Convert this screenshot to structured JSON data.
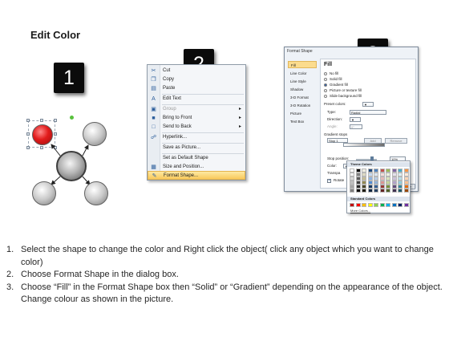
{
  "page_title": "Edit Color",
  "steps": [
    "1",
    "2",
    "3"
  ],
  "context_menu": {
    "items": [
      {
        "label": "Cut",
        "icon": "scissors-icon",
        "glyph": "✂"
      },
      {
        "label": "Copy",
        "icon": "copy-icon",
        "glyph": "❐"
      },
      {
        "label": "Paste",
        "icon": "paste-icon",
        "glyph": "▤"
      },
      {
        "label": "Edit Text",
        "icon": "edit-text-icon",
        "glyph": "A"
      },
      {
        "label": "Group",
        "icon": "group-icon",
        "glyph": "▣",
        "submenu": true,
        "disabled": true
      },
      {
        "label": "Bring to Front",
        "icon": "bring-to-front-icon",
        "glyph": "■",
        "submenu": true
      },
      {
        "label": "Send to Back",
        "icon": "send-to-back-icon",
        "glyph": "□",
        "submenu": true
      },
      {
        "label": "Hyperlink...",
        "icon": "hyperlink-icon",
        "glyph": "☍"
      },
      {
        "label": "Save as Picture...",
        "icon": "",
        "glyph": ""
      },
      {
        "label": "Set as Default Shape",
        "icon": "",
        "glyph": ""
      },
      {
        "label": "Size and Position...",
        "icon": "size-position-icon",
        "glyph": "▦"
      },
      {
        "label": "Format Shape...",
        "icon": "format-shape-icon",
        "glyph": "✎",
        "highlighted": true
      }
    ]
  },
  "dialog": {
    "title": "Format Shape",
    "nav": [
      "Fill",
      "Line Color",
      "Line Style",
      "Shadow",
      "3-D Format",
      "3-D Rotation",
      "Picture",
      "Text Box"
    ],
    "active_nav": "Fill",
    "heading": "Fill",
    "fill_options": [
      {
        "label": "No fill",
        "selected": false
      },
      {
        "label": "Solid fill",
        "selected": false
      },
      {
        "label": "Gradient fill",
        "selected": true
      },
      {
        "label": "Picture or texture fill",
        "selected": false
      },
      {
        "label": "Slide background fill",
        "selected": false
      }
    ],
    "preset_colors": "Preset colors:",
    "type_label": "Type:",
    "type_value": "Radial",
    "direction_label": "Direction:",
    "angle_label": "Angle:",
    "angle_value": "0°",
    "gradient_stops_label": "Gradient stops",
    "stop_value": "Stop 1",
    "add_label": "Add",
    "remove_label": "Remove",
    "stop_position_label": "Stop position:",
    "stop_position_value": "10%",
    "color_label": "Color:",
    "transparency_label": "Transpa",
    "rotate_label": "Rotate",
    "close_label": "se",
    "theme_colors_label": "Theme Colors",
    "standard_colors_label": "Standard Colors",
    "more_colors_label": "More Colors...",
    "theme_colors": [
      [
        "#ffffff",
        "#000000",
        "#eeece1",
        "#1f497d",
        "#4f81bd",
        "#c0504d",
        "#9bbb59",
        "#8064a2",
        "#4bacc6",
        "#f79646"
      ],
      [
        "#f2f2f2",
        "#7f7f7f",
        "#ddd9c3",
        "#c6d9f0",
        "#dbe5f1",
        "#f2dcdb",
        "#ebf1dd",
        "#e5e0ec",
        "#dbeef3",
        "#fdeada"
      ],
      [
        "#d8d8d8",
        "#595959",
        "#c4bd97",
        "#8db3e2",
        "#b8cce4",
        "#e5b9b7",
        "#d7e3bc",
        "#ccc1d9",
        "#b7dde8",
        "#fbd5b5"
      ],
      [
        "#bfbfbf",
        "#3f3f3f",
        "#938953",
        "#548dd4",
        "#95b3d7",
        "#d99694",
        "#c3d69b",
        "#b2a2c7",
        "#92cddc",
        "#fac08f"
      ],
      [
        "#a5a5a5",
        "#262626",
        "#494429",
        "#17365d",
        "#366092",
        "#953734",
        "#76923c",
        "#5f497a",
        "#31859b",
        "#e36c09"
      ],
      [
        "#7f7f7f",
        "#0c0c0c",
        "#1d1b10",
        "#0f243e",
        "#244061",
        "#632423",
        "#4f6128",
        "#3f3151",
        "#205867",
        "#974806"
      ]
    ],
    "standard_colors": [
      "#c00000",
      "#ff0000",
      "#ffc000",
      "#ffff00",
      "#92d050",
      "#00b050",
      "#00b0f0",
      "#0070c0",
      "#002060",
      "#7030a0"
    ]
  },
  "instructions": [
    {
      "num": "1.",
      "text": "Select the shape to change the color and Right click the object( click any object which you want to change color)"
    },
    {
      "num": "2.",
      "text": "Choose Format Shape in the dialog box."
    },
    {
      "num": "3.",
      "text": "Choose “Fill” in the Format Shape box then “Solid” or “Gradient” depending on the appearance of the object. Change colour as shown in the picture."
    }
  ]
}
